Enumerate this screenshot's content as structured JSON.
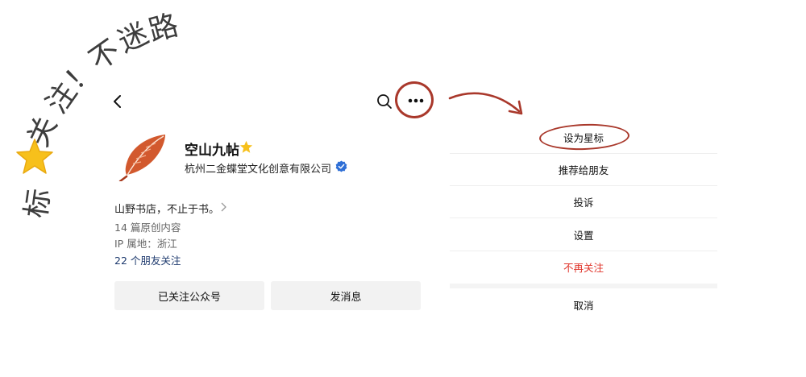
{
  "decoration": {
    "handwriting_chars": [
      "标",
      "关",
      "注",
      "！",
      "不",
      "迷",
      "路"
    ]
  },
  "profile": {
    "name": "空山九帖",
    "company": "杭州二金蝶堂文化创意有限公司",
    "bio": "山野书店，不止于书。",
    "articles": "14 篇原创内容",
    "ip_location": "IP 属地：浙江",
    "friends_prefix": "22 个",
    "friends_link": "朋友关注",
    "follow_button": "已关注公众号",
    "message_button": "发消息"
  },
  "menu": {
    "items": [
      {
        "label": "设为星标",
        "style": "normal"
      },
      {
        "label": "推荐给朋友",
        "style": "normal"
      },
      {
        "label": "投诉",
        "style": "normal"
      },
      {
        "label": "设置",
        "style": "normal"
      },
      {
        "label": "不再关注",
        "style": "danger"
      }
    ],
    "cancel": "取消"
  },
  "colors": {
    "accent_red": "#a9382b",
    "danger": "#e0362c",
    "star": "#f7c01b",
    "verify_blue": "#2f6fd6",
    "link_blue": "#1e3a6e"
  }
}
